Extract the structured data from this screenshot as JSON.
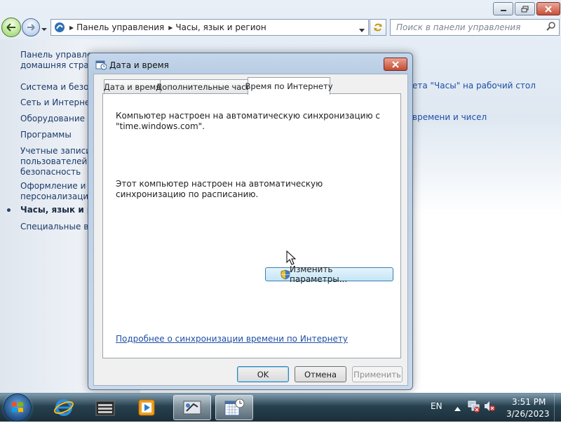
{
  "control_panel": {
    "breadcrumb": [
      "Панель управления",
      "Часы, язык и регион"
    ],
    "search_placeholder": "Поиск в панели управления",
    "left_nav": [
      {
        "label": "Панель управлен",
        "sub": "домашняя страни"
      },
      {
        "label": "Система и безопа"
      },
      {
        "label": "Сеть и Интернет"
      },
      {
        "label": "Оборудование и з"
      },
      {
        "label": "Программы"
      },
      {
        "label": "Учетные записи",
        "sub": "пользователей и",
        "sub2": "безопасность"
      },
      {
        "label": "Оформление и",
        "sub": "персонализация"
      },
      {
        "label": "Часы, язык и рег",
        "current": true
      },
      {
        "label": "Специальные воз"
      }
    ],
    "right_fragments": [
      "ета \"Часы\" на рабочий стол",
      "времени и чисел"
    ]
  },
  "dialog": {
    "title": "Дата и время",
    "tabs": [
      "Дата и время",
      "Дополнительные часы",
      "Время по Интернету"
    ],
    "active_tab": 2,
    "text1": "Компьютер настроен на автоматическую синхронизацию с \"time.windows.com\".",
    "text2": "Этот компьютер настроен на автоматическую синхронизацию по расписанию.",
    "change_button": "Изменить параметры...",
    "more_link": "Подробнее о синхронизации времени по Интернету",
    "ok": "OK",
    "cancel": "Отмена",
    "apply": "Применить"
  },
  "taskbar": {
    "language": "EN",
    "time": "3:51 PM",
    "date": "3/26/2023",
    "pinned_icons": [
      "ie-icon",
      "file-manager-icon",
      "media-player-icon",
      "control-panel-icon",
      "date-time-icon"
    ]
  },
  "colors": {
    "link": "#1f4fa5",
    "taskbar": "#1c2f3a",
    "dialog_frame": "#b8cce3"
  }
}
